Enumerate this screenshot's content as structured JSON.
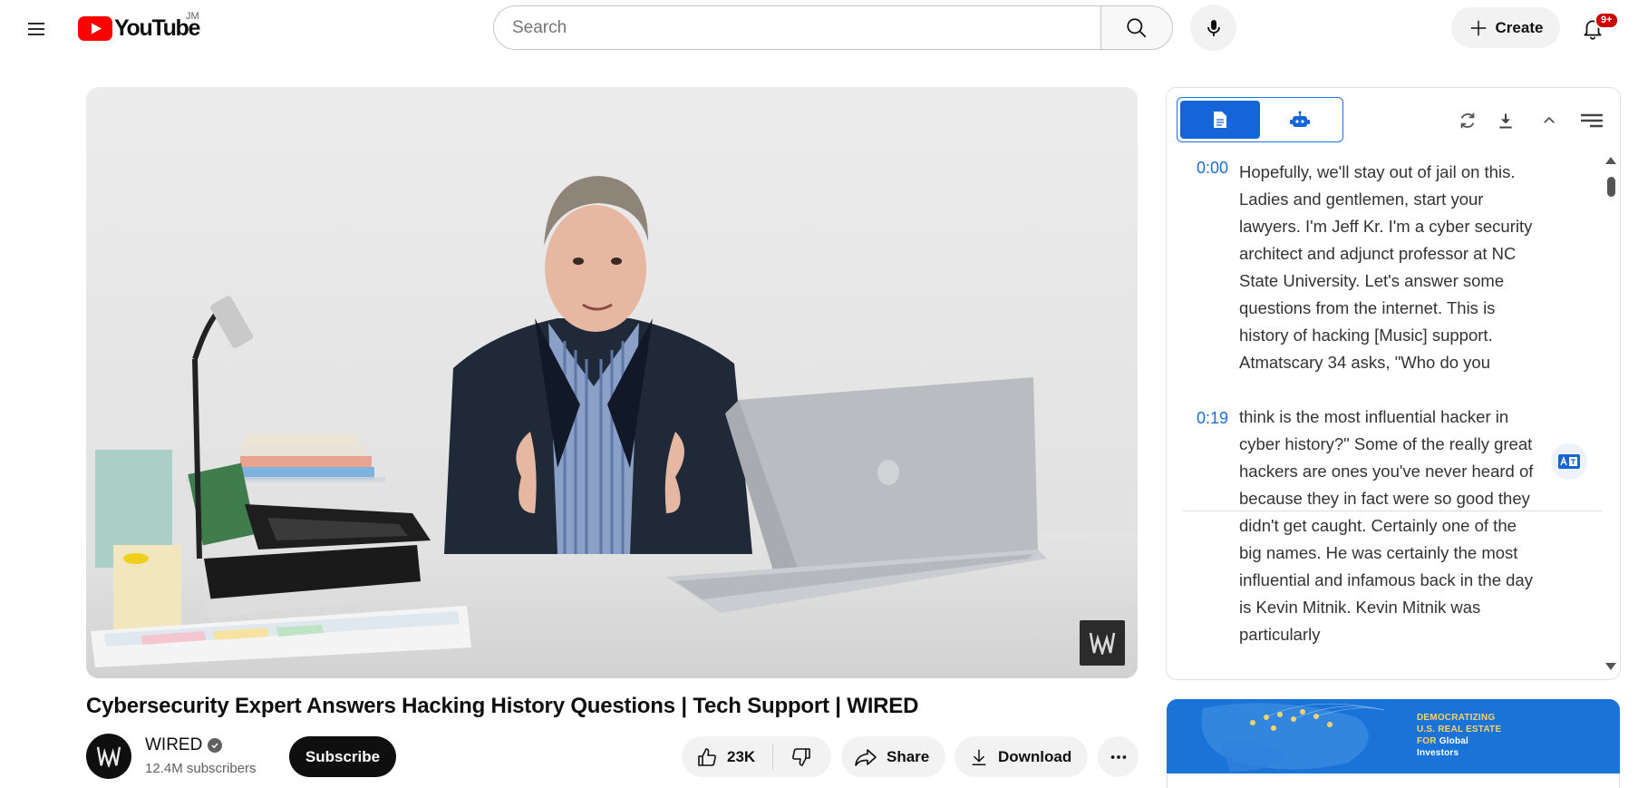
{
  "header": {
    "logo_text": "YouTube",
    "country_code": "JM",
    "search_placeholder": "Search",
    "create_label": "Create",
    "notification_count": "9+"
  },
  "video": {
    "title": "Cybersecurity Expert Answers Hacking History Questions | Tech Support | WIRED",
    "channel_name": "WIRED",
    "subscribers": "12.4M subscribers",
    "subscribe_label": "Subscribe",
    "likes": "23K",
    "share_label": "Share",
    "download_label": "Download"
  },
  "transcript": {
    "segments": [
      {
        "time": "0:00",
        "text": "Hopefully, we'll stay out of jail on this. Ladies and gentlemen, start your lawyers. I'm Jeff Kr. I'm a cyber security architect and adjunct professor at NC State University. Let's answer some questions from the internet. This is history of hacking [Music] support. Atmatscary 34 asks, \"Who do you"
      },
      {
        "time": "0:19",
        "text": "think is the most influential hacker in cyber history?\" Some of the really great hackers are ones you've never heard of because they in fact were so good they didn't get caught. Certainly one of the big names. He was certainly the most influential and infamous back in the day is Kevin Mitnik. Kevin Mitnik was particularly"
      }
    ]
  },
  "ad": {
    "line1": "DEMOCRATIZING",
    "line2": "U.S. REAL ESTATE",
    "line3_prefix": "FOR",
    "line3_suffix": "Global",
    "line4": "Investors"
  },
  "icons": {
    "menu": "hamburger-icon",
    "search": "search-icon",
    "mic": "mic-icon",
    "create": "plus-icon",
    "bell": "bell-icon",
    "like": "thumbs-up-icon",
    "dislike": "thumbs-down-icon",
    "share": "share-arrow-icon",
    "download": "download-icon",
    "more": "more-horizontal-icon",
    "transcript_tab": "document-icon",
    "ai_tab": "robot-icon",
    "refresh": "refresh-icon",
    "transcript_download": "download-icon",
    "collapse": "chevron-up-icon",
    "settings": "lines-menu-icon",
    "translate": "translate-icon"
  },
  "colors": {
    "brand_red": "#ff0000",
    "accent_blue": "#1565d8",
    "timestamp_blue": "#1a6dd5",
    "badge_red": "#cc0000",
    "ad_blue": "#1a73d6"
  }
}
